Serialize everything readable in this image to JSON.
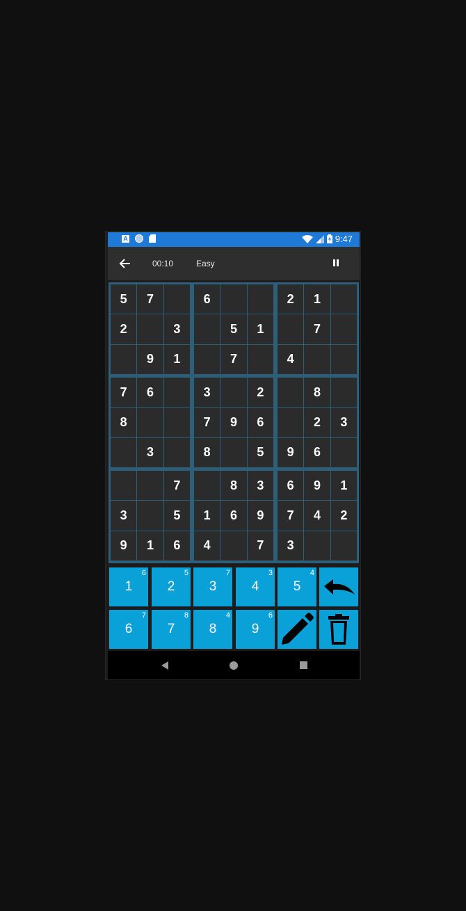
{
  "status_bar": {
    "time": "9:47",
    "notification_icons": [
      "app-a-icon",
      "circle-notification-icon",
      "sd-card-icon"
    ],
    "system_icons": [
      "wifi-icon",
      "signal-icon",
      "battery-icon"
    ]
  },
  "toolbar": {
    "timer": "00:10",
    "difficulty": "Easy"
  },
  "board": {
    "boxes": [
      [
        [
          "5",
          "7",
          ""
        ],
        [
          "2",
          "",
          "3"
        ],
        [
          "",
          "9",
          "1"
        ]
      ],
      [
        [
          "6",
          "",
          ""
        ],
        [
          "",
          "5",
          "1"
        ],
        [
          "",
          "7",
          ""
        ]
      ],
      [
        [
          "2",
          "1",
          ""
        ],
        [
          "",
          "7",
          ""
        ],
        [
          "4",
          "",
          ""
        ]
      ],
      [
        [
          "7",
          "6",
          ""
        ],
        [
          "8",
          "",
          ""
        ],
        [
          "",
          "3",
          ""
        ]
      ],
      [
        [
          "3",
          "",
          "2"
        ],
        [
          "7",
          "9",
          "6"
        ],
        [
          "8",
          "",
          "5"
        ]
      ],
      [
        [
          "",
          "8",
          ""
        ],
        [
          "",
          "2",
          "3"
        ],
        [
          "9",
          "6",
          ""
        ]
      ],
      [
        [
          "",
          "",
          "7"
        ],
        [
          "3",
          "",
          "5"
        ],
        [
          "9",
          "1",
          "6"
        ]
      ],
      [
        [
          "",
          "8",
          "3"
        ],
        [
          "1",
          "6",
          "9"
        ],
        [
          "4",
          "",
          "7"
        ]
      ],
      [
        [
          "6",
          "9",
          "1"
        ],
        [
          "7",
          "4",
          "2"
        ],
        [
          "3",
          "",
          ""
        ]
      ]
    ]
  },
  "keypad": {
    "keys": [
      {
        "digit": "1",
        "remaining": "6"
      },
      {
        "digit": "2",
        "remaining": "5"
      },
      {
        "digit": "3",
        "remaining": "7"
      },
      {
        "digit": "4",
        "remaining": "3"
      },
      {
        "digit": "5",
        "remaining": "4"
      },
      {
        "digit": "6",
        "remaining": "7"
      },
      {
        "digit": "7",
        "remaining": "8"
      },
      {
        "digit": "8",
        "remaining": "4"
      },
      {
        "digit": "9",
        "remaining": "6"
      }
    ],
    "action_icons": [
      "undo-icon",
      "pencil-icon",
      "trash-icon"
    ]
  },
  "colors": {
    "status_bar": "#1e7ad6",
    "key_background": "#0aa0d8",
    "grid_lines": "#2d5f78",
    "cell_background": "#2b2b2b"
  }
}
